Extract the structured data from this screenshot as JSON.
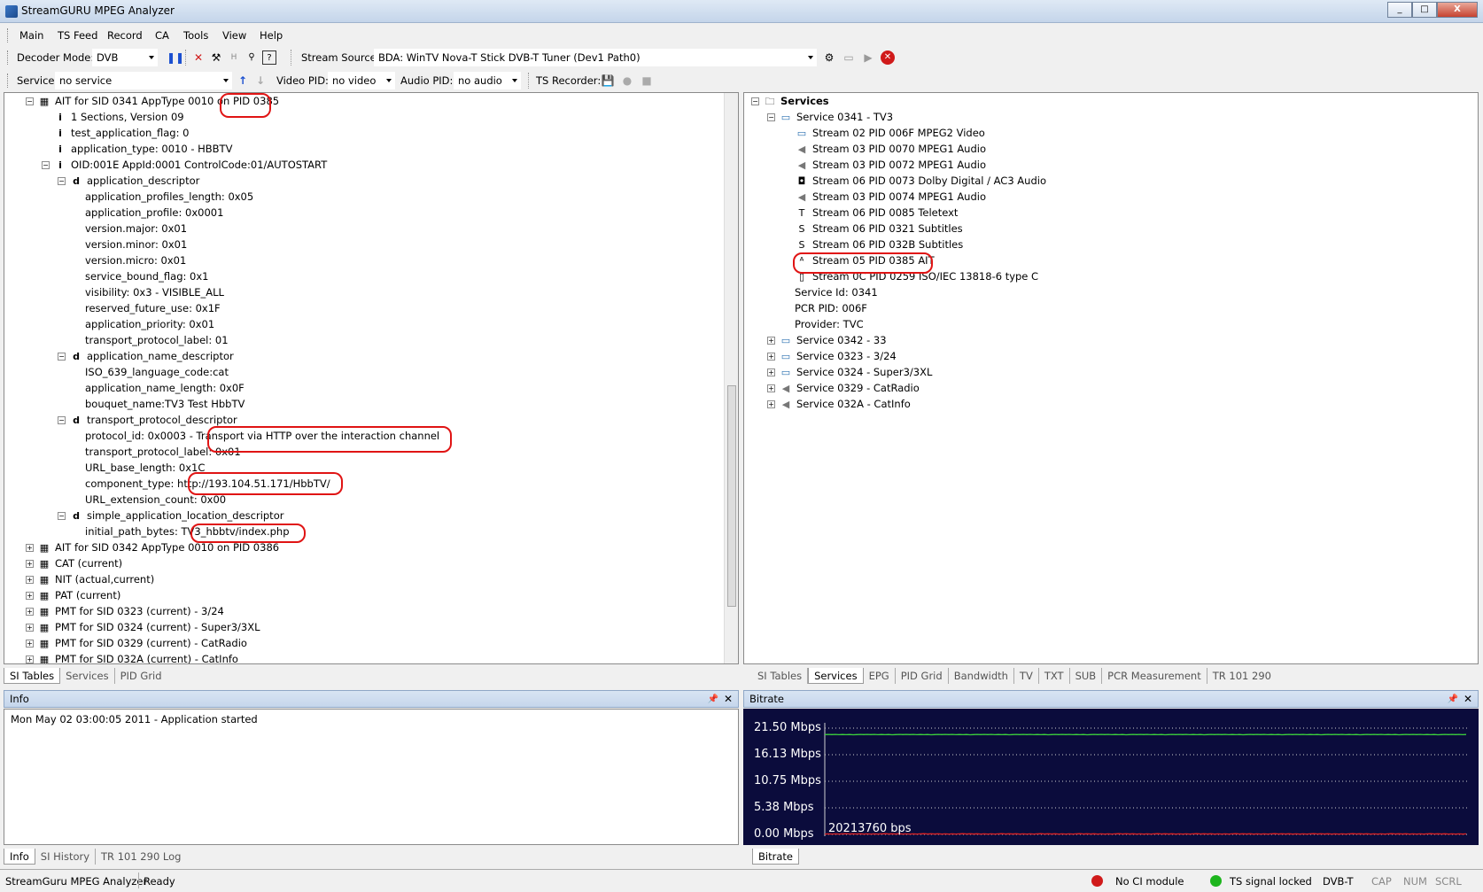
{
  "window": {
    "title": "StreamGURU MPEG Analyzer",
    "min": "_",
    "max": "□",
    "close": "X"
  },
  "menu": [
    "Main",
    "TS Feed",
    "Record",
    "CA",
    "Tools",
    "View",
    "Help"
  ],
  "toolbar2": {
    "decoder_label": "Decoder Mode:",
    "decoder_value": "DVB",
    "source_label": "Stream Source:",
    "source_value": "BDA: WinTV Nova-T Stick DVB-T Tuner (Dev1 Path0)"
  },
  "toolbar3": {
    "service_label": "Service:",
    "service_value": "no service",
    "video_label": "Video PID:",
    "video_value": "no video",
    "audio_label": "Audio PID:",
    "audio_value": "no audio",
    "recorder_label": "TS Recorder:"
  },
  "left_tree": [
    {
      "text": "AIT for SID 0341 AppType 0010 on PID 0385",
      "icon": "table-icon",
      "exp": "−"
    },
    {
      "text": "1 Sections, Version 09",
      "icon": "i"
    },
    {
      "text": "test_application_flag: 0",
      "icon": "i"
    },
    {
      "text": "application_type: 0010 - HBBTV",
      "icon": "i"
    },
    {
      "text": "OID:001E AppId:0001 ControlCode:01/AUTOSTART",
      "icon": "i",
      "exp": "−"
    },
    {
      "text": "application_descriptor",
      "icon": "d",
      "exp": "−"
    },
    {
      "text": "application_profiles_length: 0x05"
    },
    {
      "text": "application_profile: 0x0001"
    },
    {
      "text": "version.major: 0x01"
    },
    {
      "text": "version.minor: 0x01"
    },
    {
      "text": "version.micro: 0x01"
    },
    {
      "text": "service_bound_flag: 0x1"
    },
    {
      "text": "visibility: 0x3 - VISIBLE_ALL"
    },
    {
      "text": "reserved_future_use: 0x1F"
    },
    {
      "text": "application_priority: 0x01"
    },
    {
      "text": "transport_protocol_label: 01"
    },
    {
      "text": "application_name_descriptor",
      "icon": "d",
      "exp": "−"
    },
    {
      "text": "ISO_639_language_code:cat"
    },
    {
      "text": "application_name_length: 0x0F"
    },
    {
      "text": "bouquet_name:TV3 Test HbbTV"
    },
    {
      "text": "transport_protocol_descriptor",
      "icon": "d",
      "exp": "−"
    },
    {
      "text": "protocol_id: 0x0003 - Transport via HTTP over the interaction channel"
    },
    {
      "text": "transport_protocol_label: 0x01"
    },
    {
      "text": "URL_base_length: 0x1C"
    },
    {
      "text": "component_type: http://193.104.51.171/HbbTV/"
    },
    {
      "text": "URL_extension_count: 0x00"
    },
    {
      "text": "simple_application_location_descriptor",
      "icon": "d",
      "exp": "−"
    },
    {
      "text": "initial_path_bytes: TV3_hbbtv/index.php"
    },
    {
      "text": "AIT for SID 0342 AppType 0010 on PID 0386",
      "icon": "table-icon",
      "exp": "+"
    },
    {
      "text": "CAT (current)",
      "icon": "table-icon",
      "exp": "+"
    },
    {
      "text": "NIT (actual,current)",
      "icon": "table-icon",
      "exp": "+"
    },
    {
      "text": "PAT (current)",
      "icon": "table-icon",
      "exp": "+"
    },
    {
      "text": "PMT for SID 0323 (current) - 3/24",
      "icon": "table-icon",
      "exp": "+"
    },
    {
      "text": "PMT for SID 0324 (current) - Super3/3XL",
      "icon": "table-icon",
      "exp": "+"
    },
    {
      "text": "PMT for SID 0329 (current) - CatRadio",
      "icon": "table-icon",
      "exp": "+"
    },
    {
      "text": "PMT for SID 032A (current) - CatInfo",
      "icon": "table-icon",
      "exp": "+"
    }
  ],
  "right_tree": [
    {
      "text": "Services",
      "icon": "folder-icon",
      "exp": "−",
      "bold": true
    },
    {
      "text": "Service 0341 - TV3",
      "icon": "tv-icon",
      "exp": "−"
    },
    {
      "text": "Stream 02 PID 006F MPEG2 Video",
      "icon": "tv-icon"
    },
    {
      "text": "Stream 03 PID 0070 MPEG1 Audio",
      "icon": "speaker-icon"
    },
    {
      "text": "Stream 03 PID 0072 MPEG1 Audio",
      "icon": "speaker-icon"
    },
    {
      "text": "Stream 06 PID 0073 Dolby Digital / AC3 Audio",
      "icon": "dolby-icon"
    },
    {
      "text": "Stream 03 PID 0074 MPEG1 Audio",
      "icon": "speaker-icon"
    },
    {
      "text": "Stream 06 PID 0085 Teletext",
      "icon": "teletext-icon"
    },
    {
      "text": "Stream 06 PID 0321 Subtitles",
      "icon": "subtitle-icon"
    },
    {
      "text": "Stream 06 PID 032B Subtitles",
      "icon": "subtitle-icon"
    },
    {
      "text": "Stream 05 PID 0385 AIT",
      "icon": "ait-icon"
    },
    {
      "text": "Stream 0C PID 0259 ISO/IEC 13818-6 type C",
      "icon": "data-icon"
    },
    {
      "text": "Service Id: 0341"
    },
    {
      "text": "PCR PID: 006F"
    },
    {
      "text": "Provider: TVC"
    },
    {
      "text": "Service 0342 - 33",
      "icon": "tv-icon",
      "exp": "+"
    },
    {
      "text": "Service 0323 - 3/24",
      "icon": "tv-icon",
      "exp": "+"
    },
    {
      "text": "Service 0324 - Super3/3XL",
      "icon": "tv-icon",
      "exp": "+"
    },
    {
      "text": "Service 0329 - CatRadio",
      "icon": "speaker-icon",
      "exp": "+"
    },
    {
      "text": "Service 032A - CatInfo",
      "icon": "speaker-icon",
      "exp": "+"
    }
  ],
  "left_tabs": [
    "SI Tables",
    "Services",
    "PID Grid"
  ],
  "right_tabs": [
    "SI Tables",
    "Services",
    "EPG",
    "PID Grid",
    "Bandwidth",
    "TV",
    "TXT",
    "SUB",
    "PCR Measurement",
    "TR 101 290"
  ],
  "info_panel": {
    "title": "Info",
    "log": "Mon May 02 03:00:05 2011 - Application started",
    "tabs": [
      "Info",
      "SI History",
      "TR 101 290 Log"
    ]
  },
  "bitrate_panel": {
    "title": "Bitrate",
    "tabs": [
      "Bitrate"
    ]
  },
  "chart_data": {
    "type": "line",
    "ylabels": [
      "21.50 Mbps",
      "16.13 Mbps",
      "10.75 Mbps",
      "5.38 Mbps",
      "0.00 Mbps"
    ],
    "ylim": [
      0,
      21.5
    ],
    "readout": "20213760 bps",
    "series": [
      {
        "color": "#3cd23c",
        "level_mbps": 20.2
      },
      {
        "color": "#e02424",
        "level_mbps": 0.1
      }
    ],
    "background": "#0b0c3c"
  },
  "statusbar": {
    "app": "StreamGuru MPEG Analyzer",
    "state": "Ready",
    "ci": "No CI module",
    "signal": "TS signal locked",
    "mode": "DVB-T",
    "cap": "CAP",
    "num": "NUM",
    "scrl": "SCRL",
    "colors": {
      "ci_led": "#d01a1a",
      "signal_led": "#1db51d"
    }
  }
}
